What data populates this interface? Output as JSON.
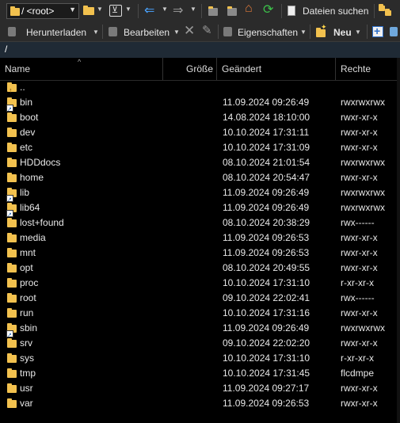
{
  "toolbar1": {
    "path_combo": "/ <root>",
    "find_files": "Dateien suchen"
  },
  "toolbar2": {
    "download": "Herunterladen",
    "edit": "Bearbeiten",
    "properties": "Eigenschaften",
    "new": "Neu"
  },
  "pathbar": {
    "path": "/"
  },
  "columns": {
    "name": "Name",
    "size": "Größe",
    "changed": "Geändert",
    "rights": "Rechte"
  },
  "colors": {
    "accent": "#2b6ec9",
    "folder": "#f2c14e",
    "pathbar": "#1f2a35"
  },
  "rows": [
    {
      "name": "..",
      "changed": "",
      "rights": "",
      "icon": "parent-folder-icon"
    },
    {
      "name": "bin",
      "changed": "11.09.2024 09:26:49",
      "rights": "rwxrwxrwx",
      "icon": "symlink-folder-icon"
    },
    {
      "name": "boot",
      "changed": "14.08.2024 18:10:00",
      "rights": "rwxr-xr-x",
      "icon": "folder-icon"
    },
    {
      "name": "dev",
      "changed": "10.10.2024 17:31:11",
      "rights": "rwxr-xr-x",
      "icon": "folder-icon"
    },
    {
      "name": "etc",
      "changed": "10.10.2024 17:31:09",
      "rights": "rwxr-xr-x",
      "icon": "folder-icon"
    },
    {
      "name": "HDDdocs",
      "changed": "08.10.2024 21:01:54",
      "rights": "rwxrwxrwx",
      "icon": "folder-icon"
    },
    {
      "name": "home",
      "changed": "08.10.2024 20:54:47",
      "rights": "rwxr-xr-x",
      "icon": "folder-icon"
    },
    {
      "name": "lib",
      "changed": "11.09.2024 09:26:49",
      "rights": "rwxrwxrwx",
      "icon": "symlink-folder-icon"
    },
    {
      "name": "lib64",
      "changed": "11.09.2024 09:26:49",
      "rights": "rwxrwxrwx",
      "icon": "symlink-folder-icon"
    },
    {
      "name": "lost+found",
      "changed": "08.10.2024 20:38:29",
      "rights": "rwx------",
      "icon": "folder-icon"
    },
    {
      "name": "media",
      "changed": "11.09.2024 09:26:53",
      "rights": "rwxr-xr-x",
      "icon": "folder-icon"
    },
    {
      "name": "mnt",
      "changed": "11.09.2024 09:26:53",
      "rights": "rwxr-xr-x",
      "icon": "folder-icon"
    },
    {
      "name": "opt",
      "changed": "08.10.2024 20:49:55",
      "rights": "rwxr-xr-x",
      "icon": "folder-icon"
    },
    {
      "name": "proc",
      "changed": "10.10.2024 17:31:10",
      "rights": "r-xr-xr-x",
      "icon": "folder-icon"
    },
    {
      "name": "root",
      "changed": "09.10.2024 22:02:41",
      "rights": "rwx------",
      "icon": "folder-icon"
    },
    {
      "name": "run",
      "changed": "10.10.2024 17:31:16",
      "rights": "rwxr-xr-x",
      "icon": "folder-icon"
    },
    {
      "name": "sbin",
      "changed": "11.09.2024 09:26:49",
      "rights": "rwxrwxrwx",
      "icon": "symlink-folder-icon"
    },
    {
      "name": "srv",
      "changed": "09.10.2024 22:02:20",
      "rights": "rwxr-xr-x",
      "icon": "folder-icon"
    },
    {
      "name": "sys",
      "changed": "10.10.2024 17:31:10",
      "rights": "r-xr-xr-x",
      "icon": "folder-icon"
    },
    {
      "name": "tmp",
      "changed": "10.10.2024 17:31:45",
      "rights": "flcdmpe",
      "icon": "folder-icon"
    },
    {
      "name": "usr",
      "changed": "11.09.2024 09:27:17",
      "rights": "rwxr-xr-x",
      "icon": "folder-icon"
    },
    {
      "name": "var",
      "changed": "11.09.2024 09:26:53",
      "rights": "rwxr-xr-x",
      "icon": "folder-icon"
    }
  ]
}
